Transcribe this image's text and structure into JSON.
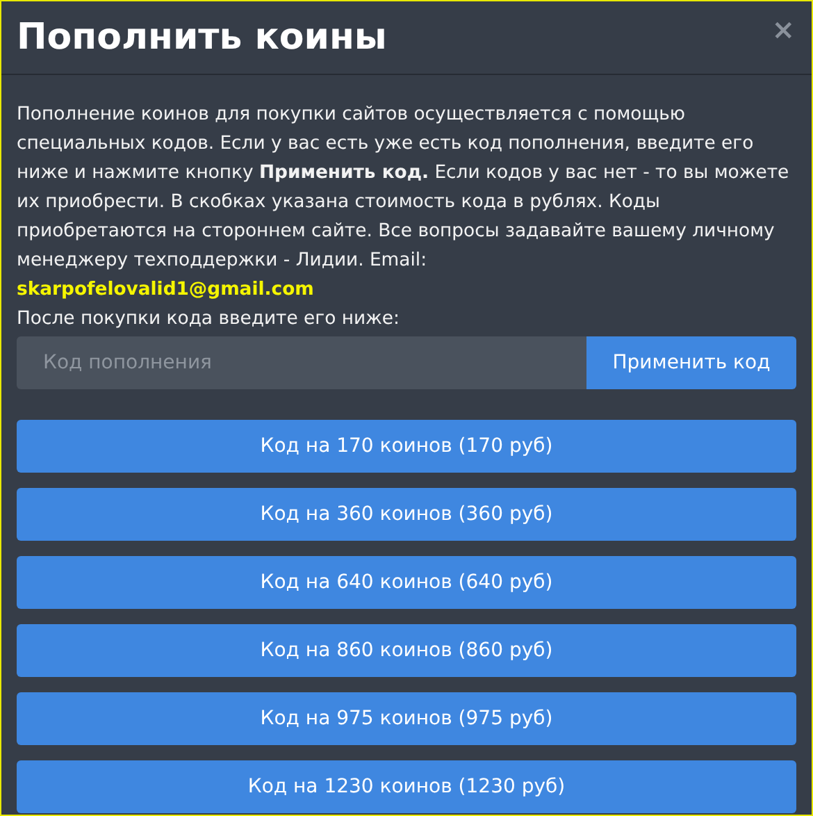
{
  "dialog": {
    "title": "Пополнить коины",
    "close": "×"
  },
  "description": "Пополнение коинов для покупки сайтов осуществляется с помощью специальных кодов. Если у вас есть уже есть код пополнения, введите его ниже и нажмите кнопку **Применить код.** Если кодов у вас нет - то вы можете их приобрести. В скобках указана стоимость кода в рублях. Коды приобретаются на стороннем сайте. Все вопросы задавайте вашему личному менеджеру техподдержки - Лидии. Email:",
  "email": "skarpofelovalid1@gmail.com",
  "instruction": "После покупки кода введите его ниже:",
  "code_field": {
    "placeholder": "Код пополнения"
  },
  "apply_button": "Применить код",
  "packages": [
    {
      "label": "Код на 170 коинов (170 руб)"
    },
    {
      "label": "Код на 360 коинов (360 руб)"
    },
    {
      "label": "Код на 640 коинов (640 руб)"
    },
    {
      "label": "Код на 860 коинов (860 руб)"
    },
    {
      "label": "Код на 975 коинов (975 руб)"
    },
    {
      "label": "Код на 1230 коинов (1230 руб)"
    }
  ]
}
